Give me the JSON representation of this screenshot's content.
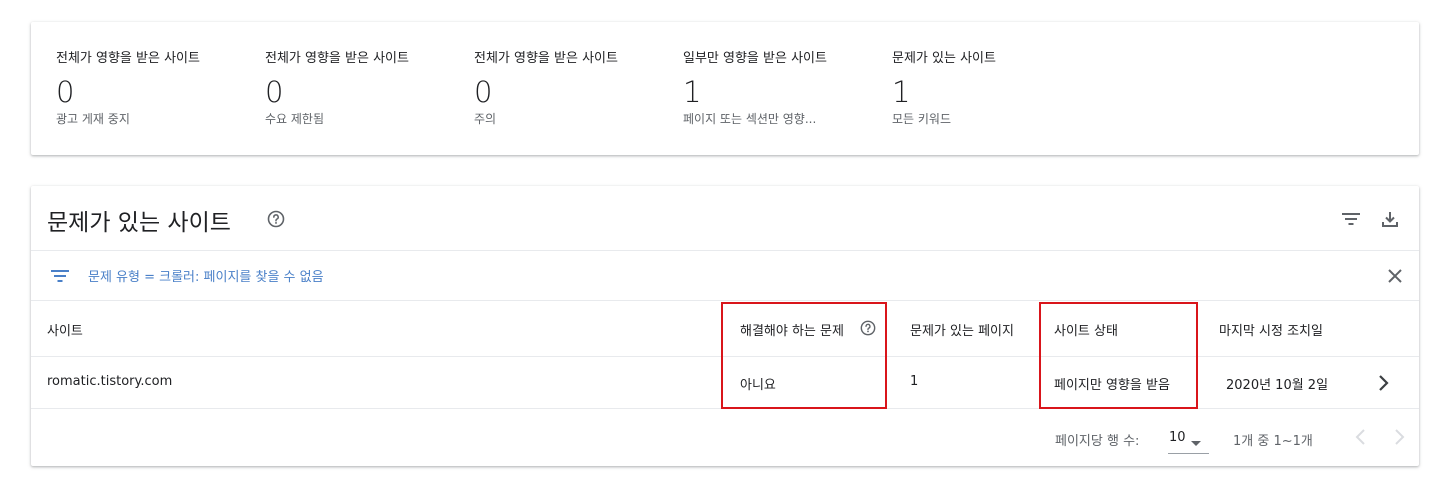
{
  "summary": {
    "stats": [
      {
        "title": "전체가 영향을 받은 사이트",
        "value": "0",
        "sub": "광고 게재 중지"
      },
      {
        "title": "전체가 영향을 받은 사이트",
        "value": "0",
        "sub": "수요 제한됨"
      },
      {
        "title": "전체가 영향을 받은 사이트",
        "value": "0",
        "sub": "주의"
      },
      {
        "title": "일부만 영향을 받은 사이트",
        "value": "1",
        "sub": "페이지 또는 섹션만 영향..."
      },
      {
        "title": "문제가 있는 사이트",
        "value": "1",
        "sub": "모든 키워드"
      }
    ]
  },
  "issues": {
    "title": "문제가 있는 사이트",
    "filter_text": "문제 유형 = 크롤러: 페이지를 찾을 수 없음",
    "columns": {
      "site": "사이트",
      "needs_fix": "해결해야 하는 문제",
      "pages": "문제가 있는 페이지",
      "status": "사이트 상태",
      "last_action": "마지막 시정 조치일"
    },
    "rows": [
      {
        "site": "romatic.tistory.com",
        "needs_fix": "아니요",
        "pages": "1",
        "status": "페이지만 영향을 받음",
        "last_action": "2020년 10월 2일"
      }
    ],
    "footer": {
      "rows_per_page_label": "페이지당 행 수:",
      "rows_per_page_value": "10",
      "range": "1개 중 1~1개"
    }
  },
  "colors": {
    "accent_blue": "#4a80c8",
    "highlight_red": "#d9151b",
    "icon_gray": "#5f6368"
  }
}
